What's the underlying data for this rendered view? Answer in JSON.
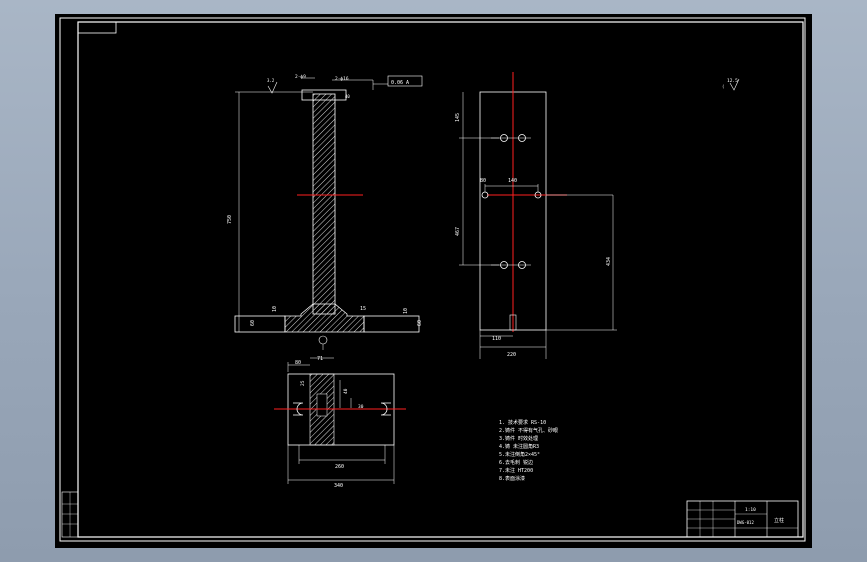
{
  "drawing": {
    "front_view": {
      "dim_height": "750",
      "dim_base_left": "60",
      "dim_base_mid_left": "10",
      "dim_base_mid_right": "15",
      "dim_base_right": "10",
      "dim_base_far_right": "60",
      "top_callout_1": "2-ф9",
      "top_callout_2": "2-ф16",
      "top_dim_small": "40",
      "tol_frame": "0.06 A",
      "roughness_value": "3.2"
    },
    "side_view": {
      "dim_top_offset": "145",
      "dim_hole_spacing": "467",
      "dim_slot_left": "80",
      "dim_slot_width": "140",
      "dim_right_height": "434",
      "dim_bottom_small": "110",
      "dim_bottom_width": "220"
    },
    "bottom_view": {
      "dim_top_left": "80",
      "dim_top_right": "71",
      "dim_left_a": "25",
      "dim_mid": "40",
      "dim_right_a": "30",
      "dim_inner_width": "260",
      "dim_outer_width": "340"
    },
    "roughness_note": "12.5",
    "notes": [
      "1. 技术要求 RS-10",
      "2.铸件 不得有气孔、砂眼",
      "3.铸件 时效处理",
      "4.铸 未注圆角R3",
      "5.未注倒角2×45°",
      "6.去毛刺 锐边",
      "7.未注 HT200",
      "8.表面涂漆"
    ],
    "title_block": {
      "scale": "1:10",
      "name": "立柱",
      "code": "DWG-012"
    }
  },
  "colors": {
    "background_window": "#9aa8ba",
    "paper": "#000000",
    "line": "#ffffff",
    "centerline": "#ff2020",
    "annotation": "#ffffff"
  }
}
